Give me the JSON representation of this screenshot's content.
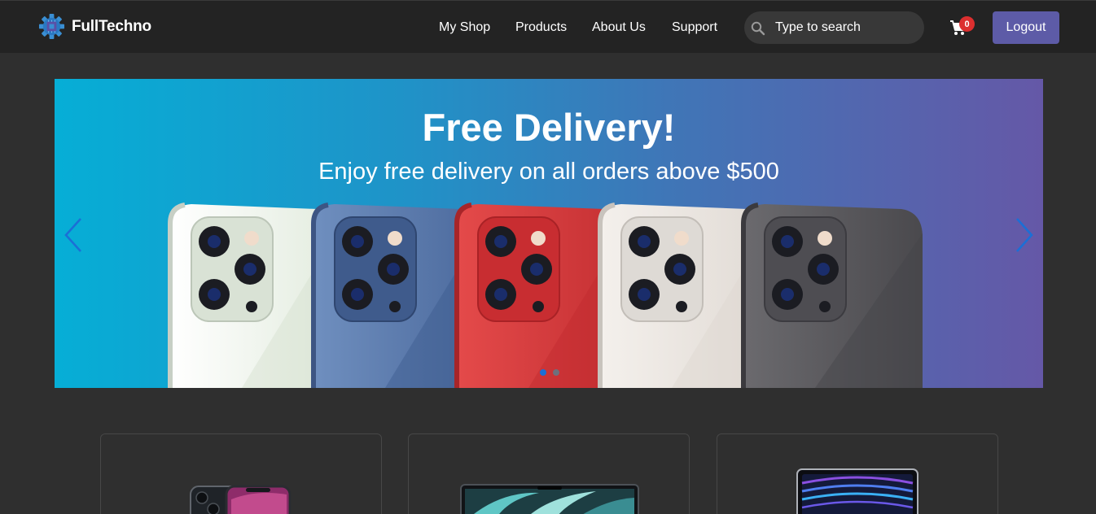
{
  "brand": {
    "name": "FullTechno",
    "logo": "gear-chip-logo"
  },
  "nav": {
    "links": [
      "My Shop",
      "Products",
      "About Us",
      "Support"
    ]
  },
  "search": {
    "placeholder": "Type to search",
    "icon": "search-icon"
  },
  "cart": {
    "count": "0",
    "icon": "cart-icon"
  },
  "logout_label": "Logout",
  "hero": {
    "title": "Free Delivery!",
    "subtitle": "Enjoy free delivery on all orders above $500",
    "slide_count": 2,
    "active_slide": 1
  },
  "products": [
    {
      "image": "iphone-image"
    },
    {
      "image": "macbook-image"
    },
    {
      "image": "ipad-image"
    }
  ],
  "colors": {
    "navbar": "#232323",
    "page": "#2f2f2f",
    "logout": "#5d5ba7",
    "badge": "#dc2f2f",
    "gradient_start": "#06aed6",
    "gradient_end": "#6558a7"
  }
}
